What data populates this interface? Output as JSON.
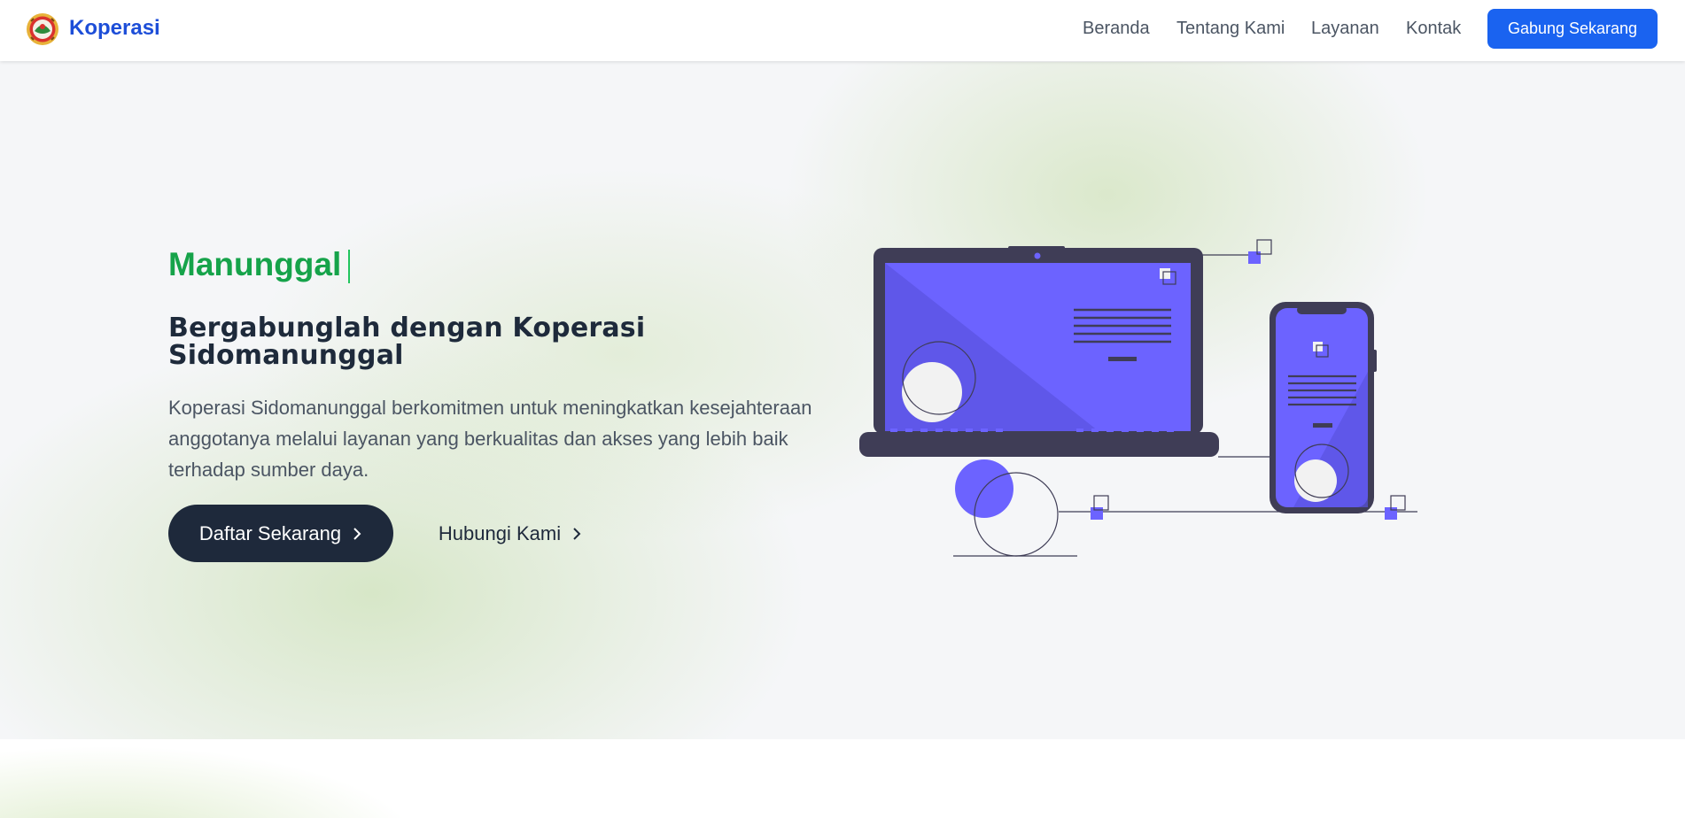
{
  "navbar": {
    "brand": "Koperasi",
    "links": [
      "Beranda",
      "Tentang Kami",
      "Layanan",
      "Kontak"
    ],
    "cta": "Gabung Sekarang"
  },
  "hero": {
    "typed_text": "Manunggal",
    "title": "Bergabunglah dengan Koperasi Sidomanunggal",
    "description": "Koperasi Sidomanunggal berkomitmen untuk meningkatkan kesejahteraan anggotanya melalui layanan yang berkualitas dan akses yang lebih baik terhadap sumber daya.",
    "primary_button": "Daftar Sekarang",
    "secondary_button": "Hubungi Kami"
  },
  "icons": {
    "logo": "cooperative-emblem-icon",
    "chevron": "chevron-right-icon",
    "illustration": "laptop-phone-illustration"
  },
  "colors": {
    "brand": "#1d4ed8",
    "accent_green": "#16a34a",
    "cta_blue": "#1a63f0",
    "dark_button": "#1e293b",
    "illustration_purple": "#6c63ff"
  }
}
